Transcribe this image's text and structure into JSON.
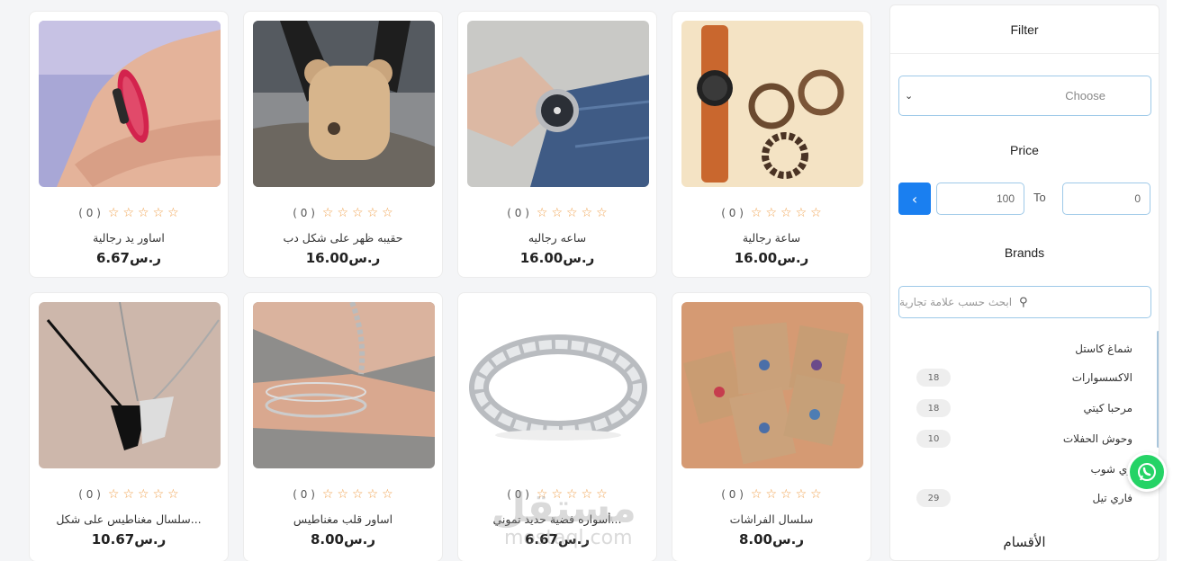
{
  "products": [
    {
      "name": "اساور يد رجالية",
      "price": "6.67ر.س",
      "rating_count": "( 0 )",
      "image": "red-rope-bracelet"
    },
    {
      "name": "حقيبه ظهر على شكل دب",
      "price": "16.00ر.س",
      "rating_count": "( 0 )",
      "image": "bear-backpack"
    },
    {
      "name": "ساعه رجاليه",
      "price": "16.00ر.س",
      "rating_count": "( 0 )",
      "image": "steel-watch"
    },
    {
      "name": "ساعة رجالية",
      "price": "16.00ر.س",
      "rating_count": "( 0 )",
      "image": "leather-watch-set"
    },
    {
      "name": "سلسال مغناطيس على شكل...",
      "price": "10.67ر.س",
      "rating_count": "( 0 )",
      "image": "heart-necklace"
    },
    {
      "name": "اساور قلب مغناطيس",
      "price": "8.00ر.س",
      "rating_count": "( 0 )",
      "image": "chain-bracelet"
    },
    {
      "name": "أسواره فضية حديد تموني...",
      "price": "6.67ر.س",
      "rating_count": "( 0 )",
      "image": "silver-link-bracelet"
    },
    {
      "name": "سلسال الفراشات",
      "price": "8.00ر.س",
      "rating_count": "( 0 )",
      "image": "butterfly-necklaces"
    }
  ],
  "sidebar": {
    "filter_title": "Filter",
    "choose_placeholder": "Choose",
    "price_title": "Price",
    "price_to_label": "To",
    "price_max": "100",
    "price_min": "0",
    "brands_title": "Brands",
    "brand_search_placeholder": "ابحث حسب علامة تجارية",
    "brands": [
      {
        "name": "شماغ كاستل",
        "count": ""
      },
      {
        "name": "الاكسسوارات",
        "count": "18"
      },
      {
        "name": "مرحبا كيتي",
        "count": "18"
      },
      {
        "name": "وحوش الحفلات",
        "count": "10"
      },
      {
        "name": "زي شوب",
        "count": ""
      },
      {
        "name": "فاري تيل",
        "count": "29"
      }
    ],
    "categories_title": "الأقسام"
  },
  "watermark": {
    "text": "مستقل",
    "sub": "mostaql.com"
  },
  "colors": {
    "accent": "#1a7ff0",
    "star": "#f0a04b",
    "whatsapp": "#25d366"
  }
}
